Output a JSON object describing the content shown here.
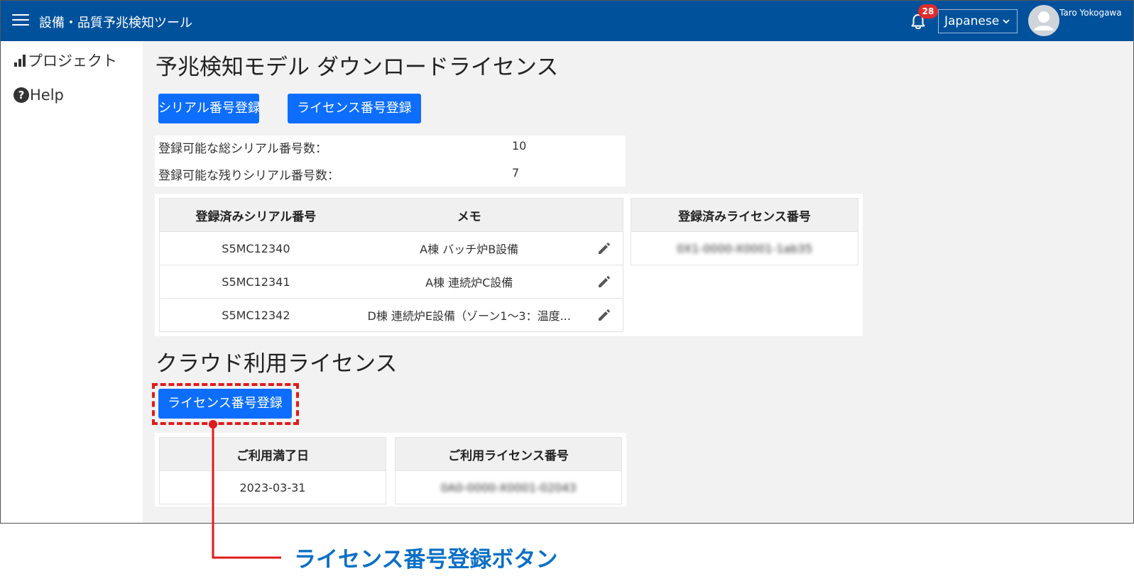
{
  "header": {
    "title": "設備・品質予兆検知ツール",
    "notification_count": "28",
    "language": "Japanese",
    "user_name": "Taro Yokogawa"
  },
  "sidebar": {
    "items": [
      {
        "label": "プロジェクト",
        "icon": "bar-chart-icon"
      },
      {
        "label": "Help",
        "icon": "help-circle-icon"
      }
    ]
  },
  "main": {
    "title": "予兆検知モデル ダウンロードライセンス",
    "serial_button": "シリアル番号登録",
    "license_button": "ライセンス番号登録",
    "counts": [
      {
        "label": "登録可能な総シリアル番号数：",
        "value": "10"
      },
      {
        "label": "登録可能な残りシリアル番号数：",
        "value": "7"
      }
    ],
    "serial_table": {
      "headers": [
        "登録済みシリアル番号",
        "メモ"
      ],
      "rows": [
        {
          "serial": "S5MC12340",
          "memo": "A棟 バッチ炉B設備"
        },
        {
          "serial": "S5MC12341",
          "memo": "A棟 連続炉C設備"
        },
        {
          "serial": "S5MC12342",
          "memo": "D棟 連続炉E設備（ゾーン1～3：温度..."
        }
      ]
    },
    "license_table": {
      "header": "登録済みライセンス番号",
      "rows": [
        "0X1-0000-X0001-1ab35"
      ]
    }
  },
  "cloud": {
    "title": "クラウド利用ライセンス",
    "license_button": "ライセンス番号登録",
    "table": {
      "headers": [
        "ご利用満了日",
        "ご利用ライセンス番号"
      ],
      "rows": [
        {
          "expiry": "2023-03-31",
          "license": "0A0-0000-X0001-02043"
        }
      ]
    }
  },
  "callout": {
    "label": "ライセンス番号登録ボタン",
    "color": "#e01b1b",
    "label_color": "#0b6fc6"
  },
  "colors": {
    "header": "#00519c",
    "primary_button": "#0d6efd",
    "badge": "#e02b2b"
  }
}
